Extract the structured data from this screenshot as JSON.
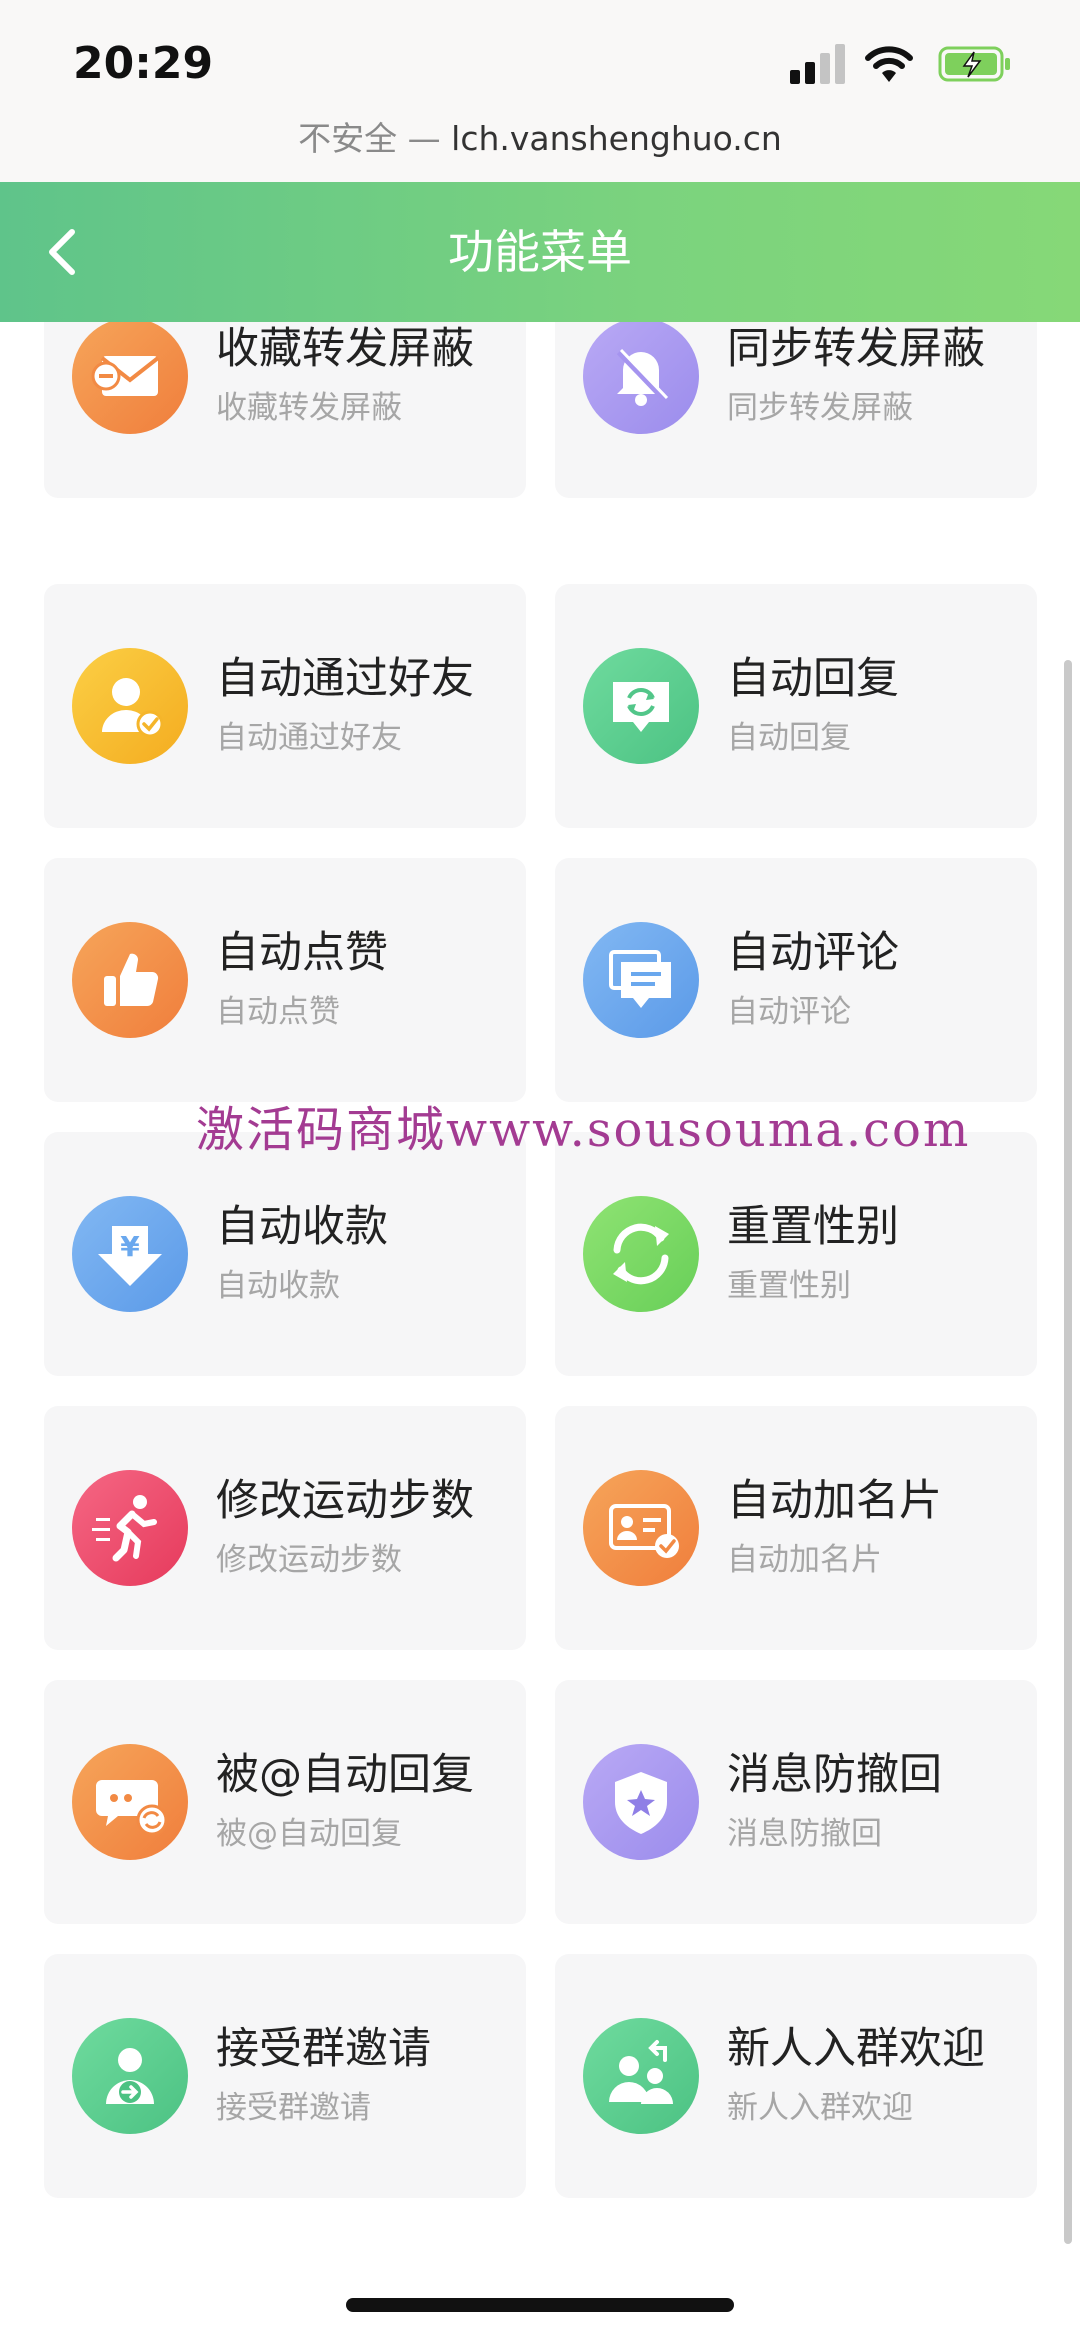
{
  "status_bar": {
    "time": "20:29",
    "url_insecure": "不安全 —",
    "url_domain": "lch.vanshenghuo.cn"
  },
  "nav": {
    "title": "功能菜单"
  },
  "theme": {
    "accent": "#6ccc85",
    "card_bg": "#f6f6f7",
    "watermark": "#a33b92"
  },
  "watermark": "激活码商城www.sousouma.com",
  "features": [
    {
      "title": "收藏转发屏蔽",
      "subtitle": "收藏转发屏蔽",
      "icon": "mail-block-icon",
      "color": "#f4934a"
    },
    {
      "title": "同步转发屏蔽",
      "subtitle": "同步转发屏蔽",
      "icon": "bell-off-icon",
      "color": "#a99af0"
    },
    {
      "title": "自动通过好友",
      "subtitle": "自动通过好友",
      "icon": "user-check-icon",
      "color": "#f7bd2f"
    },
    {
      "title": "自动回复",
      "subtitle": "自动回复",
      "icon": "reply-chat-icon",
      "color": "#5ccf8e"
    },
    {
      "title": "自动点赞",
      "subtitle": "自动点赞",
      "icon": "thumbs-up-icon",
      "color": "#f4934a"
    },
    {
      "title": "自动评论",
      "subtitle": "自动评论",
      "icon": "comment-icon",
      "color": "#6aa8ee"
    },
    {
      "title": "自动收款",
      "subtitle": "自动收款",
      "icon": "yuan-download-icon",
      "color": "#6aa8ee"
    },
    {
      "title": "重置性别",
      "subtitle": "重置性别",
      "icon": "refresh-icon",
      "color": "#78d964"
    },
    {
      "title": "修改运动步数",
      "subtitle": "修改运动步数",
      "icon": "runner-icon",
      "color": "#ee4b6a"
    },
    {
      "title": "自动加名片",
      "subtitle": "自动加名片",
      "icon": "id-card-icon",
      "color": "#f4934a"
    },
    {
      "title": "被@自动回复",
      "subtitle": "被@自动回复",
      "icon": "mention-reply-icon",
      "color": "#f4934a"
    },
    {
      "title": "消息防撤回",
      "subtitle": "消息防撤回",
      "icon": "shield-star-icon",
      "color": "#a99af0"
    },
    {
      "title": "接受群邀请",
      "subtitle": "接受群邀请",
      "icon": "user-arrow-icon",
      "color": "#5ccf8e"
    },
    {
      "title": "新人入群欢迎",
      "subtitle": "新人入群欢迎",
      "icon": "group-welcome-icon",
      "color": "#5ccf8e"
    }
  ]
}
